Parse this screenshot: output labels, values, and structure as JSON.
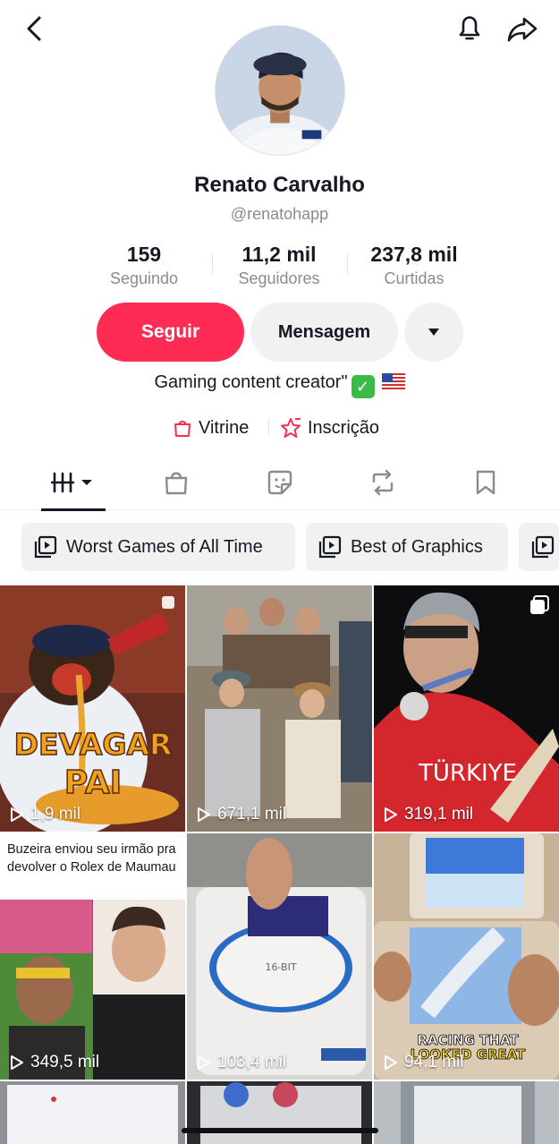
{
  "header": {
    "back_icon": "chevron-left-icon",
    "bell_icon": "bell-icon",
    "share_icon": "share-arrow-icon"
  },
  "profile": {
    "name": "Renato Carvalho",
    "handle": "@renatohapp",
    "avatar_desc": "avatar"
  },
  "stats": [
    {
      "value": "159",
      "label": "Seguindo"
    },
    {
      "value": "11,2 mil",
      "label": "Seguidores"
    },
    {
      "value": "237,8 mil",
      "label": "Curtidas"
    }
  ],
  "actions": {
    "follow_label": "Seguir",
    "message_label": "Mensagem",
    "more_icon": "caret-down-icon"
  },
  "bio": {
    "text": "Gaming content creator\"",
    "emoji_check": "✓"
  },
  "links": [
    {
      "label": "Vitrine",
      "icon": "shopping-bag-icon"
    },
    {
      "label": "Inscrição",
      "icon": "star-badge-icon"
    }
  ],
  "tabs": [
    {
      "name": "videos",
      "icon": "grid-bars-icon"
    },
    {
      "name": "shop",
      "icon": "bag-icon"
    },
    {
      "name": "stickers",
      "icon": "sticker-icon"
    },
    {
      "name": "reposts",
      "icon": "repost-icon"
    },
    {
      "name": "favorites",
      "icon": "bookmark-icon"
    }
  ],
  "playlists": [
    {
      "label": "Worst Games of All Time"
    },
    {
      "label": "Best of Graphics"
    },
    {
      "label": ""
    }
  ],
  "videos": [
    {
      "views": "1,9 mil",
      "overlay_top": "DEVAGAR",
      "overlay_bottom": "PAI"
    },
    {
      "views": "671,1 mil"
    },
    {
      "views": "319,1 mil",
      "overlay_text": "TÜRKIYE"
    },
    {
      "views": "349,5 mil",
      "caption": "Buzeira enviou seu irmão pra devolver o Rolex de Maumau"
    },
    {
      "views": "103,4 mil",
      "overlay_text": "16-BIT"
    },
    {
      "views": "94,1 mil",
      "overlay_top": "RACING THAT",
      "overlay_bottom": "LOOKED GREAT"
    }
  ],
  "colors": {
    "accent": "#fe2c55",
    "text": "#161823",
    "muted": "#8a8b91",
    "chip_bg": "#f1f1f2"
  }
}
